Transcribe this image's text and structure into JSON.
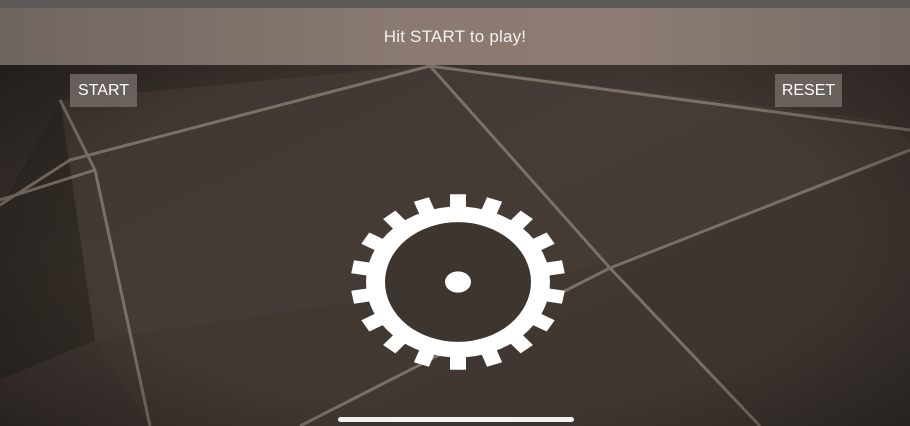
{
  "banner": {
    "message": "Hit START to play!"
  },
  "controls": {
    "start_label": "START",
    "reset_label": "RESET"
  },
  "reticle": {
    "icon": "gear-icon"
  },
  "colors": {
    "banner": "#8a7a72",
    "button": "#78706c",
    "text": "#ffffff",
    "floor": "#3a332e"
  }
}
